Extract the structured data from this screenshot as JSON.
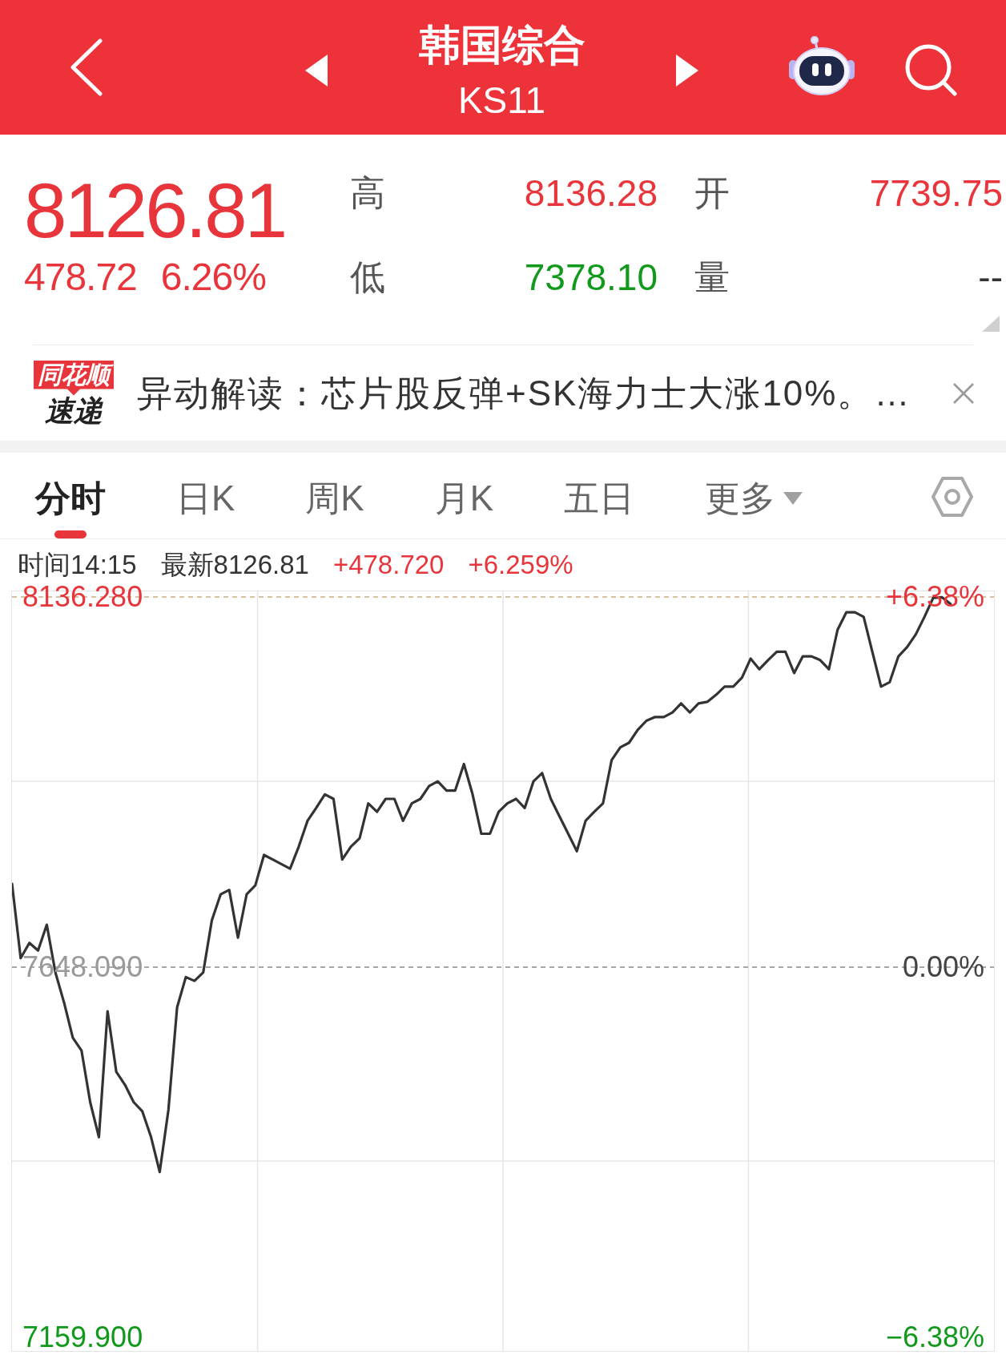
{
  "header": {
    "title": "韩国综合",
    "code": "KS11"
  },
  "quote": {
    "rising": true,
    "price": "8126.81",
    "change": "478.72",
    "change_percent": "6.26%",
    "stats": [
      {
        "label": "高",
        "value": "8136.28",
        "color": "#e8353b"
      },
      {
        "label": "开",
        "value": "7739.75",
        "color": "#e8353b"
      },
      {
        "label": "低",
        "value": "7378.10",
        "color": "#11991b"
      },
      {
        "label": "量",
        "value": "--",
        "color": "#333333"
      }
    ]
  },
  "news": {
    "source_badge": "同花顺",
    "source_label": "速递",
    "text": "异动解读：芯片股反弹+SK海力士大涨10%。…"
  },
  "tabs": [
    {
      "label": "分时",
      "selected": true,
      "kind": "tab"
    },
    {
      "label": "日K",
      "selected": false,
      "kind": "tab"
    },
    {
      "label": "周K",
      "selected": false,
      "kind": "tab"
    },
    {
      "label": "月K",
      "selected": false,
      "kind": "tab"
    },
    {
      "label": "五日",
      "selected": false,
      "kind": "tab"
    },
    {
      "label": "更多",
      "selected": false,
      "kind": "dropdown"
    }
  ],
  "info_line": [
    {
      "text": "时间14:15",
      "color": "#333333"
    },
    {
      "text": "最新8126.81",
      "color": "#333333"
    },
    {
      "text": "+478.720",
      "color": "#e8353b"
    },
    {
      "text": "+6.259%",
      "color": "#e8353b"
    }
  ],
  "chart": {
    "percent_labels": [
      "+6.38%",
      "0.00%",
      "−6.38%"
    ],
    "chart_data": {
      "type": "line",
      "ylim": [
        7141.94,
        8143.68
      ],
      "yticks": [
        {
          "value": 8136.28,
          "label": "8136.280"
        },
        {
          "value": 7648.09,
          "label": "7648.090"
        },
        {
          "value": 7159.9,
          "label": "7159.900"
        }
      ],
      "ref_lines": [
        {
          "axis": "y",
          "value": 8136.28,
          "color": "#c9ad82"
        },
        {
          "axis": "y",
          "value": 7648.09,
          "color": "#8a8a8a"
        }
      ],
      "series": [
        {
          "color": "#333333",
          "values": [
            7758,
            7660,
            7680,
            7670,
            7704,
            7641,
            7601,
            7555,
            7538,
            7470,
            7424,
            7590,
            7510,
            7493,
            7470,
            7458,
            7424,
            7378,
            7460,
            7595,
            7635,
            7630,
            7641,
            7710,
            7744,
            7750,
            7687,
            7744,
            7756,
            7796,
            7790,
            7784,
            7778,
            7807,
            7841,
            7858,
            7876,
            7870,
            7790,
            7807,
            7818,
            7864,
            7853,
            7870,
            7870,
            7841,
            7864,
            7870,
            7887,
            7893,
            7881,
            7881,
            7916,
            7876,
            7824,
            7824,
            7853,
            7864,
            7870,
            7858,
            7893,
            7904,
            7870,
            7847,
            7824,
            7801,
            7841,
            7853,
            7864,
            7921,
            7938,
            7944,
            7961,
            7973,
            7978,
            7978,
            7984,
            7996,
            7984,
            7996,
            7998,
            8007,
            8018,
            8018,
            8030,
            8055,
            8041,
            8053,
            8064,
            8064,
            8036,
            8058,
            8058,
            8053,
            8041,
            8093,
            8116,
            8116,
            8110,
            8064,
            8018,
            8024,
            8058,
            8070,
            8087,
            8110,
            8135,
            8136,
            8127,
            null,
            null,
            null,
            null,
            null
          ]
        }
      ]
    }
  }
}
